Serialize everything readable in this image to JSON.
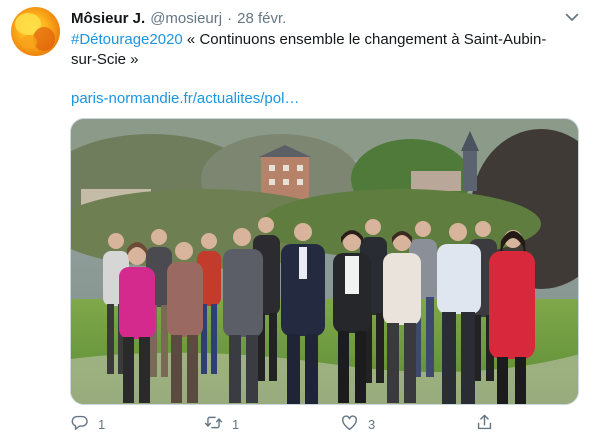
{
  "tweet": {
    "author_name": "Môsieur J.",
    "handle": "@mosieurj",
    "separator": "·",
    "date": "28 févr.",
    "hashtag": "#Détourage2020",
    "text": " « Continuons ensemble le changement à Saint-Aubin-sur-Scie »",
    "link": "paris-normandie.fr/actualites/pol…"
  },
  "icons": {
    "avatar": "avatar",
    "menu": "chevron-down-icon",
    "reply": "reply-icon",
    "retweet": "retweet-icon",
    "like": "heart-icon",
    "share": "share-icon"
  },
  "actions": {
    "reply_count": "1",
    "retweet_count": "1",
    "like_count": "3"
  },
  "colors": {
    "link": "#1b95e0",
    "secondary_text": "#657786",
    "primary_text": "#14171a"
  }
}
